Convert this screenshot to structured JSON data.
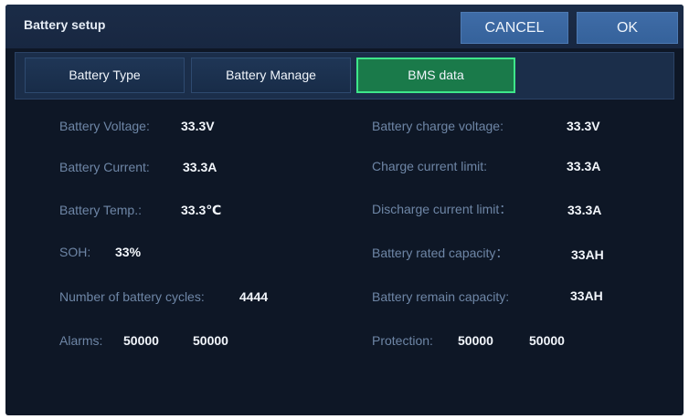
{
  "header": {
    "title": "Battery setup",
    "cancel_label": "CANCEL",
    "ok_label": "OK"
  },
  "tabs": [
    {
      "label": "Battery Type"
    },
    {
      "label": "Battery Manage"
    },
    {
      "label": "BMS data",
      "active": true
    }
  ],
  "left": {
    "voltage": {
      "label": "Battery Voltage:",
      "value": "33.3V"
    },
    "current": {
      "label": "Battery Current:",
      "value": "33.3A"
    },
    "temp": {
      "label": "Battery Temp.:",
      "value": "33.3℃"
    },
    "soh": {
      "label": "SOH:",
      "value": "33%"
    },
    "cycles": {
      "label": "Number of battery cycles:",
      "value": "4444"
    },
    "alarms": {
      "label": "Alarms:",
      "value1": "50000",
      "value2": "50000"
    }
  },
  "right": {
    "charge_voltage": {
      "label": "Battery charge voltage:",
      "value": "33.3V"
    },
    "charge_limit": {
      "label": "Charge current limit:",
      "value": "33.3A"
    },
    "discharge_limit": {
      "label": "Discharge current limit：",
      "value": "33.3A"
    },
    "rated_capacity": {
      "label": "Battery rated capacity：",
      "value": "33AH"
    },
    "remain_capacity": {
      "label": "Battery remain capacity:",
      "value": "33AH"
    },
    "protection": {
      "label": "Protection:",
      "value1": "50000",
      "value2": "50000"
    }
  },
  "colors": {
    "background": "#0e1726",
    "active_tab": "#1a7a4a",
    "button": "#3f6ca7"
  }
}
